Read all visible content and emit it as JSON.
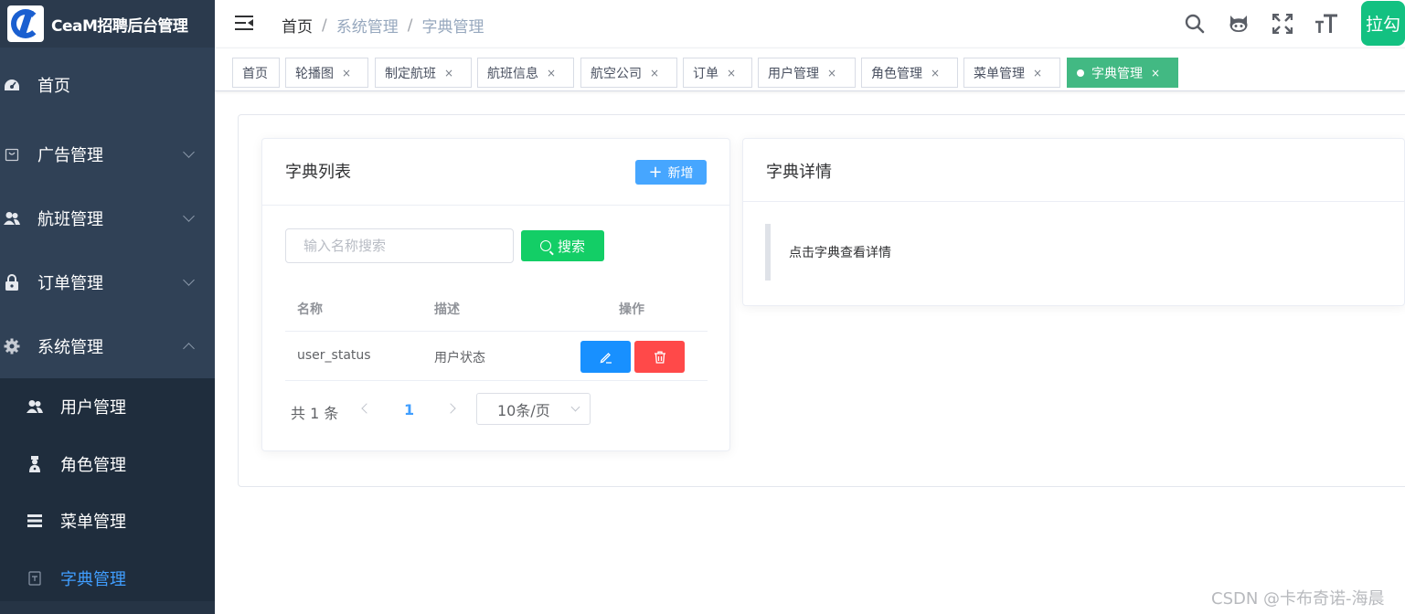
{
  "app": {
    "title": "CeaM招聘后台管理"
  },
  "sidebar": {
    "items": [
      {
        "label": "首页",
        "icon": "dashboard-icon"
      },
      {
        "label": "广告管理",
        "icon": "shopping-bag-icon"
      },
      {
        "label": "航班管理",
        "icon": "people-icon"
      },
      {
        "label": "订单管理",
        "icon": "lock-icon"
      },
      {
        "label": "系统管理",
        "icon": "gear-icon"
      }
    ],
    "system_sub": [
      {
        "label": "用户管理",
        "icon": "user-icon"
      },
      {
        "label": "角色管理",
        "icon": "role-icon"
      },
      {
        "label": "菜单管理",
        "icon": "list-icon"
      },
      {
        "label": "字典管理",
        "icon": "dictionary-icon"
      }
    ]
  },
  "header": {
    "breadcrumb": [
      "首页",
      "系统管理",
      "字典管理"
    ],
    "separator": "/",
    "avatar_text": "拉勾"
  },
  "tags": [
    {
      "label": "首页"
    },
    {
      "label": "轮播图"
    },
    {
      "label": "制定航班"
    },
    {
      "label": "航班信息"
    },
    {
      "label": "航空公司"
    },
    {
      "label": "订单"
    },
    {
      "label": "用户管理"
    },
    {
      "label": "角色管理"
    },
    {
      "label": "菜单管理"
    },
    {
      "label": "字典管理"
    }
  ],
  "tag_close_symbol": "×",
  "dict_list": {
    "title": "字典列表",
    "add_label": "新增",
    "search_placeholder": "输入名称搜索",
    "search_label": "搜索",
    "columns": [
      "名称",
      "描述",
      "操作"
    ],
    "rows": [
      {
        "name": "user_status",
        "desc": "用户状态"
      }
    ],
    "pagination": {
      "total": "共 1 条",
      "current_page": "1",
      "page_size": "10条/页"
    }
  },
  "dict_detail": {
    "title": "字典详情",
    "tip": "点击字典查看详情"
  },
  "watermark": "CSDN @卡布奇诺-海晨",
  "colors": {
    "sidebar_bg": "#304156",
    "submenu_bg": "#1f2d3d",
    "active_menu": "#409eff",
    "active_tag": "#42b983",
    "add_button": "#46a6ff",
    "search_button": "#13ce66",
    "edit_button": "#1890ff",
    "delete_button": "#ff4949",
    "avatar": "#13c181"
  }
}
